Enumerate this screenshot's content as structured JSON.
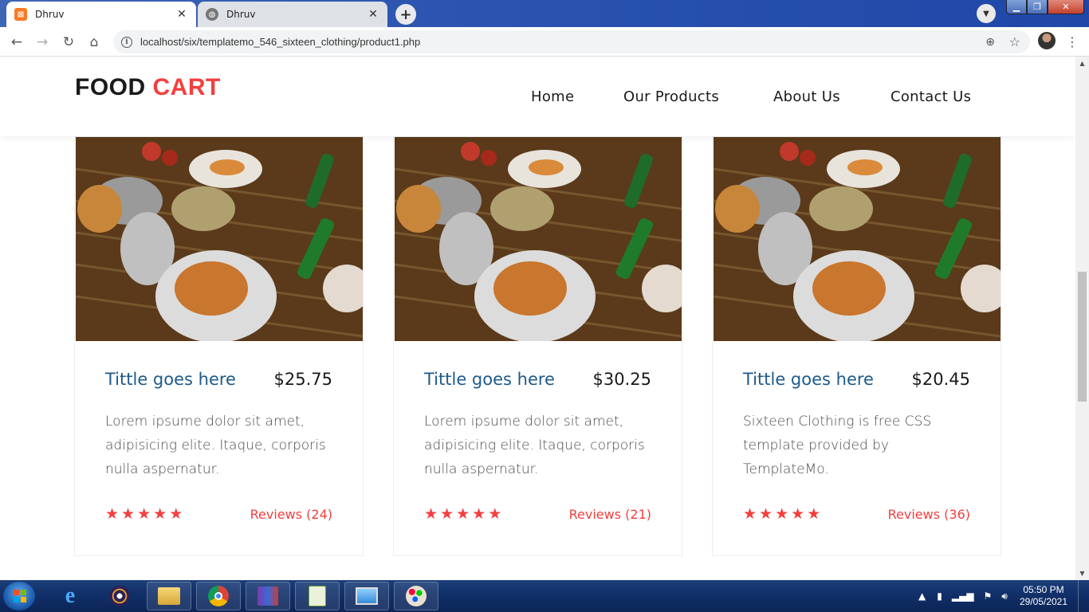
{
  "browser": {
    "tabs": [
      {
        "title": "Dhruv",
        "active": true
      },
      {
        "title": "Dhruv",
        "active": false
      }
    ],
    "url": "localhost/six/templatemo_546_sixteen_clothing/product1.php"
  },
  "site": {
    "logo_part1": "FOOD",
    "logo_part2": "CART",
    "nav": [
      "Home",
      "Our Products",
      "About Us",
      "Contact Us"
    ]
  },
  "products": [
    {
      "title": "Tittle goes here",
      "price": "$25.75",
      "description": "Lorem ipsume dolor sit amet, adipisicing elite. Itaque, corporis nulla aspernatur.",
      "reviews": "Reviews (24)",
      "rating": 5
    },
    {
      "title": "Tittle goes here",
      "price": "$30.25",
      "description": "Lorem ipsume dolor sit amet, adipisicing elite. Itaque, corporis nulla aspernatur.",
      "reviews": "Reviews (21)",
      "rating": 5
    },
    {
      "title": "Tittle goes here",
      "price": "$20.45",
      "description": "Sixteen Clothing is free CSS template provided by TemplateMo.",
      "reviews": "Reviews (36)",
      "rating": 5
    }
  ],
  "taskbar": {
    "apps": [
      "internet-explorer",
      "eclipse",
      "file-explorer",
      "chrome",
      "winrar",
      "notepad-plus",
      "photo-viewer",
      "paint"
    ],
    "clock_time": "05:50 PM",
    "clock_date": "29/05/2021"
  },
  "colors": {
    "accent": "#f33f3f",
    "title_blue": "#1d5a8a",
    "taskbar": "#12306a"
  }
}
